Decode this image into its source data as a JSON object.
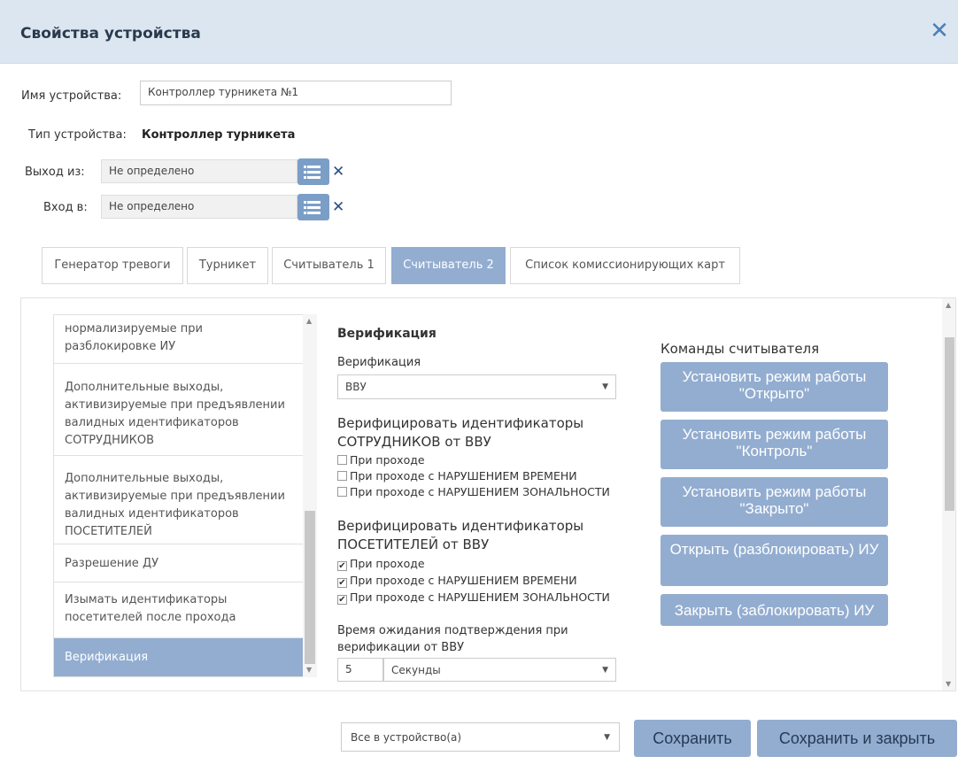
{
  "dialog": {
    "title": "Свойства устройства",
    "close_icon": "close-icon"
  },
  "form": {
    "name_label": "Имя устройства:",
    "name_value": "Контроллер турникета №1",
    "type_label": "Тип устройства:",
    "type_value": "Контроллер турникета",
    "exit_label": "Выход из:",
    "exit_value": "Не определено",
    "entry_label": "Вход в:",
    "entry_value": "Не определено"
  },
  "tabs": [
    {
      "label": "Генератор тревоги",
      "active": false
    },
    {
      "label": "Турникет",
      "active": false
    },
    {
      "label": "Считыватель 1",
      "active": false
    },
    {
      "label": "Считыватель 2",
      "active": true
    },
    {
      "label": "Список комиссионирующих карт",
      "active": false
    }
  ],
  "sidebar": {
    "items": [
      {
        "label": "нормализируемые при разблокировке ИУ",
        "active": false
      },
      {
        "label": "Дополнительные выходы, активизируемые при предъявлении валидных идентификаторов СОТРУДНИКОВ",
        "active": false
      },
      {
        "label": "Дополнительные выходы, активизируемые при предъявлении валидных идентификаторов ПОСЕТИТЕЛЕЙ",
        "active": false
      },
      {
        "label": "Разрешение ДУ",
        "active": false
      },
      {
        "label": "Изымать идентификаторы посетителей после прохода",
        "active": false
      },
      {
        "label": "Верификация",
        "active": true
      }
    ]
  },
  "verification": {
    "heading": "Верификация",
    "select_label": "Верификация",
    "select_value": "ВВУ",
    "employees_heading": "Верифицировать идентификаторы СОТРУДНИКОВ от ВВУ",
    "employees_options": [
      {
        "label": "При проходе",
        "checked": false
      },
      {
        "label": "При проходе с НАРУШЕНИЕМ ВРЕМЕНИ",
        "checked": false
      },
      {
        "label": "При проходе с НАРУШЕНИЕМ ЗОНАЛЬНОСТИ",
        "checked": false
      }
    ],
    "visitors_heading": "Верифицировать идентификаторы ПОСЕТИТЕЛЕЙ от ВВУ",
    "visitors_options": [
      {
        "label": "При проходе",
        "checked": true
      },
      {
        "label": "При проходе с НАРУШЕНИЕМ ВРЕМЕНИ",
        "checked": true
      },
      {
        "label": "При проходе с НАРУШЕНИЕМ ЗОНАЛЬНОСТИ",
        "checked": true
      }
    ],
    "wait_label": "Время ожидания подтверждения при верификации от ВВУ",
    "wait_value": "5",
    "wait_unit": "Секунды"
  },
  "commands": {
    "heading": "Команды считывателя",
    "buttons": [
      {
        "label": "Установить режим работы \"Открыто\""
      },
      {
        "label": "Установить режим работы \"Контроль\""
      },
      {
        "label": "Установить режим работы \"Закрыто\""
      },
      {
        "label": "Открыть (разблокировать) ИУ"
      },
      {
        "label": "Закрыть (заблокировать) ИУ"
      }
    ]
  },
  "footer": {
    "apply_select": "Все в устройство(а)",
    "save_label": "Сохранить",
    "save_close_label": "Сохранить и закрыть"
  },
  "colors": {
    "accent": "#93add0",
    "header_bg": "#dce6f1",
    "close": "#4a7fb8"
  }
}
